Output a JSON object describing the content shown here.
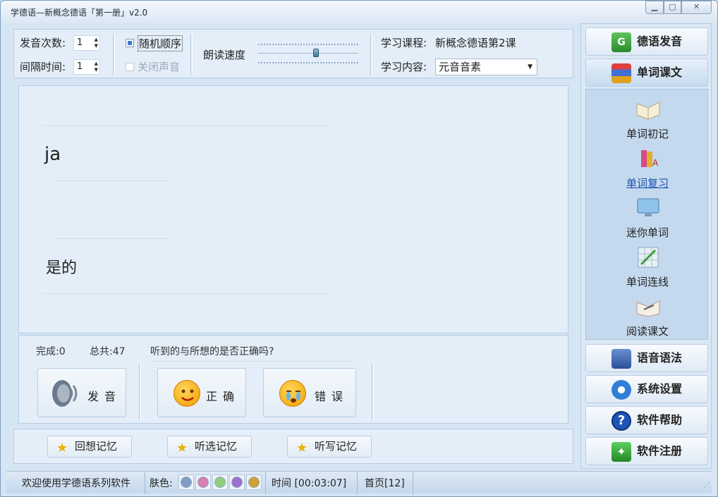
{
  "window": {
    "title": "学德语—新概念德语「第一册」v2.0"
  },
  "settings": {
    "repeat_label": "发音次数:",
    "repeat_value": "1",
    "interval_label": "间隔时间:",
    "interval_value": "1",
    "random_label": "随机顺序",
    "random_checked": true,
    "mute_label": "关闭声音",
    "mute_checked": false,
    "speed_label": "朗读速度",
    "course_label": "学习课程:",
    "course_value": "新概念德语第2课",
    "content_label": "学习内容:",
    "content_value": "元音音素"
  },
  "display": {
    "german": "ja",
    "chinese": "是的"
  },
  "controls": {
    "done_label": "完成:0",
    "total_label": "总共:47",
    "question": "听到的与所想的是否正确吗?",
    "speak_label": "发音",
    "correct_label": "正确",
    "wrong_label": "错误"
  },
  "memory": {
    "recall": "回想记忆",
    "listen_select": "听选记忆",
    "dictation": "听写记忆"
  },
  "sidebar": {
    "pronunciation": "德语发音",
    "vocab_text": "单词课文",
    "sub_items": [
      "单词初记",
      "单词复习",
      "迷你单词",
      "单词连线",
      "阅读课文"
    ],
    "grammar": "语音语法",
    "settings": "系统设置",
    "help": "软件帮助",
    "register": "软件注册"
  },
  "statusbar": {
    "welcome": "欢迎使用学德语系列软件",
    "skin_label": "肤色:",
    "skin_colors": [
      "#7f9fc4",
      "#d87fb4",
      "#8fd07f",
      "#9f6fd0",
      "#d0a030"
    ],
    "time": "时间 [00:03:07]",
    "page": "首页[12]"
  }
}
